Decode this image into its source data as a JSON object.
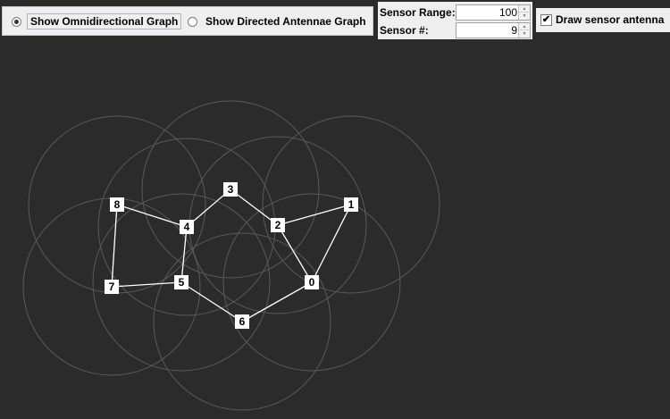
{
  "radio_options": [
    {
      "label": "Show Omnidirectional Graph",
      "checked": true
    },
    {
      "label": "Show Directed Antennae Graph",
      "checked": false
    }
  ],
  "params": {
    "range_label": "Sensor Range:",
    "range_value": "100",
    "count_label": "Sensor #:",
    "count_value": "9"
  },
  "draw_antenna": {
    "label": "Draw sensor antenna",
    "checked": true,
    "check_glyph": "✔"
  },
  "spinner_glyphs": {
    "up": "▲",
    "down": "▼"
  },
  "graph": {
    "background": "#2b2b2b",
    "range_circle_color": "#5a5a5a",
    "edge_color": "#ffffff",
    "node_fill": "#ffffff",
    "nodes": [
      {
        "id": "0"
      },
      {
        "id": "1"
      },
      {
        "id": "2"
      },
      {
        "id": "3"
      },
      {
        "id": "4"
      },
      {
        "id": "5"
      },
      {
        "id": "6"
      },
      {
        "id": "7"
      },
      {
        "id": "8"
      }
    ],
    "edges": [
      [
        "8",
        "4"
      ],
      [
        "8",
        "7"
      ],
      [
        "4",
        "3"
      ],
      [
        "4",
        "5"
      ],
      [
        "3",
        "2"
      ],
      [
        "2",
        "1"
      ],
      [
        "2",
        "0"
      ],
      [
        "1",
        "0"
      ],
      [
        "0",
        "6"
      ],
      [
        "6",
        "5"
      ],
      [
        "5",
        "7"
      ]
    ]
  }
}
